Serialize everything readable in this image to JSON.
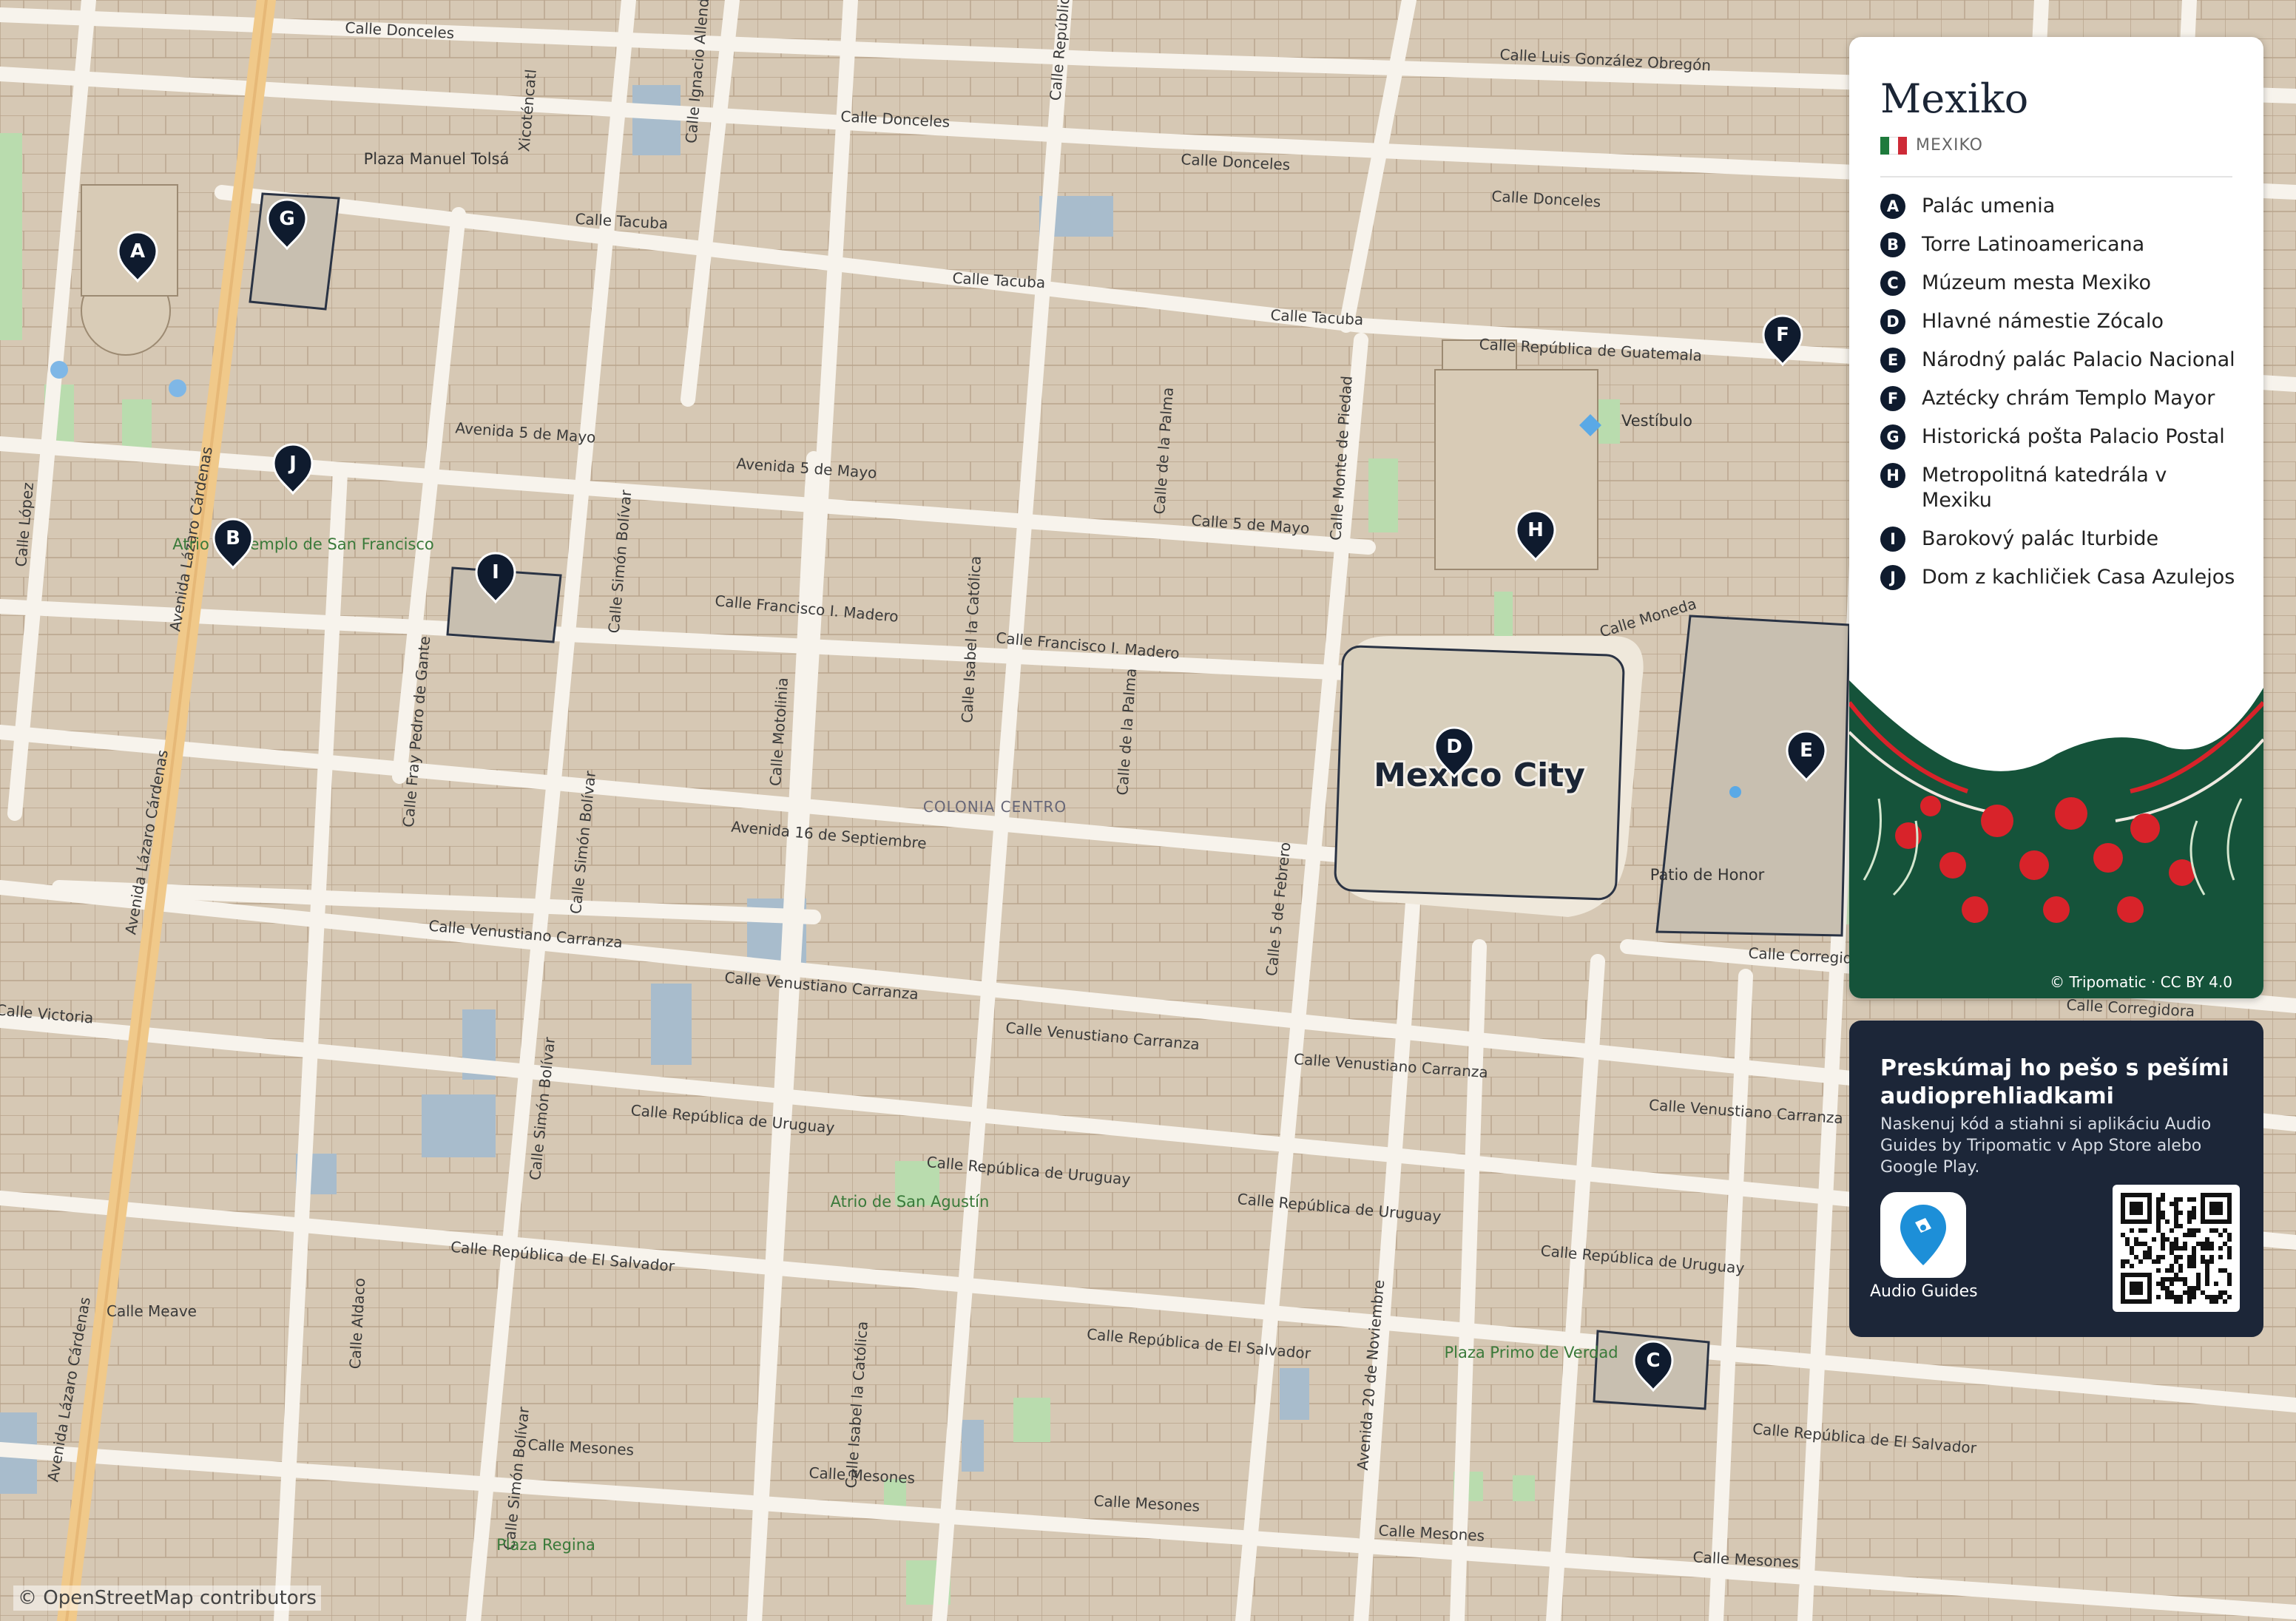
{
  "map": {
    "city_label": "Mexico City",
    "district_label": "COLONIA CENTRO",
    "attribution": "© OpenStreetMap contributors",
    "streets": [
      "Calle Donceles",
      "Calle Donceles",
      "Calle Donceles",
      "Calle Donceles",
      "Calle Luis González Obregón",
      "Calle Tacuba",
      "Calle Tacuba",
      "Calle Tacuba",
      "Calle República de Guatemala",
      "Avenida 5 de Mayo",
      "Avenida 5 de Mayo",
      "Calle 5 de Mayo",
      "Calle Francisco I. Madero",
      "Calle Francisco I. Madero",
      "Avenida 16 de Septiembre",
      "Calle Venustiano Carranza",
      "Calle Venustiano Carranza",
      "Calle Venustiano Carranza",
      "Calle Venustiano Carranza",
      "Calle Venustiano Carranza",
      "Calle República de Uruguay",
      "Calle República de Uruguay",
      "Calle República de Uruguay",
      "Calle República de Uruguay",
      "Calle República de El Salvador",
      "Calle República de El Salvador",
      "Calle República de El Salvador",
      "Calle Mesones",
      "Calle Mesones",
      "Calle Mesones",
      "Calle Mesones",
      "Calle Mesones",
      "Calle Moneda",
      "Calle Corregidora",
      "Calle Corregidora",
      "Calle Victoria",
      "Calle Meave",
      "Avenida Lázaro Cárdenas",
      "Avenida Lázaro Cárdenas",
      "Avenida Lázaro Cárdenas",
      "Calle López",
      "Xicoténcatl",
      "Calle Ignacio Allende",
      "Calle Simón Bolívar",
      "Calle Simón Bolívar",
      "Calle Simón Bolívar",
      "Calle Simón Bolívar",
      "Calle Fray Pedro de Gante",
      "Calle Motolinia",
      "Calle Isabel la Católica",
      "Calle Isabel la Católica",
      "Calle de la Palma",
      "Calle de la Palma",
      "Calle Monte de Piedad",
      "Calle 5 de Febrero",
      "Avenida 20 de Noviembre",
      "Calle Aldaco",
      "Calle República"
    ],
    "places": [
      {
        "text": "Plaza Manuel Tolsá",
        "kind": "place"
      },
      {
        "text": "Atrio del Templo de San Francisco",
        "kind": "park"
      },
      {
        "text": "Vestíbulo",
        "kind": "place"
      },
      {
        "text": "Patio de Honor",
        "kind": "place"
      },
      {
        "text": "Atrio de San Agustín",
        "kind": "park"
      },
      {
        "text": "Plaza Primo de Verdad",
        "kind": "park"
      },
      {
        "text": "Plaza Regina",
        "kind": "park"
      }
    ],
    "pins": [
      "A",
      "B",
      "C",
      "D",
      "E",
      "F",
      "G",
      "H",
      "I",
      "J"
    ]
  },
  "legend": {
    "title": "Mexiko",
    "country": "MEXIKO",
    "items": [
      {
        "letter": "A",
        "label": "Palác umenia"
      },
      {
        "letter": "B",
        "label": "Torre Latinoamericana"
      },
      {
        "letter": "C",
        "label": "Múzeum mesta Mexiko"
      },
      {
        "letter": "D",
        "label": "Hlavné námestie Zócalo"
      },
      {
        "letter": "E",
        "label": "Národný palác Palacio Nacional"
      },
      {
        "letter": "F",
        "label": "Aztécky chrám Templo Mayor"
      },
      {
        "letter": "G",
        "label": "Historická pošta Palacio Postal"
      },
      {
        "letter": "H",
        "label": "Metropolitná katedrála v Mexiku"
      },
      {
        "letter": "I",
        "label": "Barokový palác Iturbide"
      },
      {
        "letter": "J",
        "label": "Dom z kachličiek Casa Azulejos"
      }
    ],
    "credit": "© Tripomatic · CC BY 4.0",
    "colors": {
      "flag_green": "#1e7a3c",
      "flag_white": "#ffffff",
      "flag_red": "#ce2b37",
      "art_green": "#15533a",
      "art_red": "#d8232a"
    }
  },
  "promo": {
    "title": "Preskúmaj ho pešo s pešími audioprehliadkami",
    "description": "Naskenuj kód a stiahni si aplikáciu Audio Guides by Tripomatic v App Store alebo Google Play.",
    "app_label": "Audio Guides",
    "app_icon": "location-pin-icon",
    "qr_icon": "qr-code-icon",
    "accent": "#1d8fd8",
    "background": "#1c2638"
  }
}
